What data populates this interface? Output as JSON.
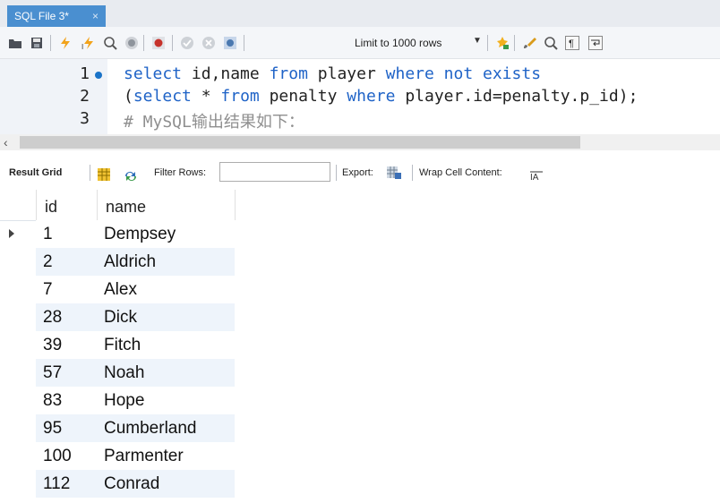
{
  "tab": {
    "title": "SQL File 3*",
    "close_glyph": "×"
  },
  "toolbar": {
    "limit_label": "Limit to 1000 rows",
    "icons": [
      "open-folder-icon",
      "save-icon",
      "execute-icon",
      "execute-current-icon",
      "explain-icon",
      "stop-icon",
      "toggle-error-icon",
      "commit-icon",
      "rollback-icon",
      "autocommit-icon",
      "beautify-icon",
      "find-icon",
      "invisible-chars-icon",
      "wrap-icon"
    ]
  },
  "editor": {
    "line_numbers": [
      "1",
      "2",
      "3"
    ],
    "lines": [
      {
        "parts": [
          {
            "t": "select",
            "c": "kw"
          },
          {
            "t": " id,name ",
            "c": "tx"
          },
          {
            "t": "from",
            "c": "kw"
          },
          {
            "t": " player ",
            "c": "tx"
          },
          {
            "t": "where not exists",
            "c": "kw"
          }
        ]
      },
      {
        "parts": [
          {
            "t": "(",
            "c": "tx"
          },
          {
            "t": "select",
            "c": "kw"
          },
          {
            "t": " * ",
            "c": "tx"
          },
          {
            "t": "from",
            "c": "kw"
          },
          {
            "t": " penalty ",
            "c": "tx"
          },
          {
            "t": "where",
            "c": "kw"
          },
          {
            "t": " player.id=penalty.p_id);",
            "c": "tx"
          }
        ]
      },
      {
        "parts": [
          {
            "t": "# MySQL输出结果如下：",
            "c": "cm"
          }
        ]
      }
    ]
  },
  "result_toolbar": {
    "result_grid": "Result Grid",
    "filter_rows": "Filter Rows:",
    "export": "Export:",
    "wrap_cell": "Wrap Cell Content:"
  },
  "grid": {
    "columns": [
      "id",
      "name"
    ],
    "rows": [
      [
        "1",
        "Dempsey"
      ],
      [
        "2",
        "Aldrich"
      ],
      [
        "7",
        "Alex"
      ],
      [
        "28",
        "Dick"
      ],
      [
        "39",
        "Fitch"
      ],
      [
        "57",
        "Noah"
      ],
      [
        "83",
        "Hope"
      ],
      [
        "95",
        "Cumberland"
      ],
      [
        "100",
        "Parmenter"
      ],
      [
        "112",
        "Conrad"
      ]
    ]
  }
}
